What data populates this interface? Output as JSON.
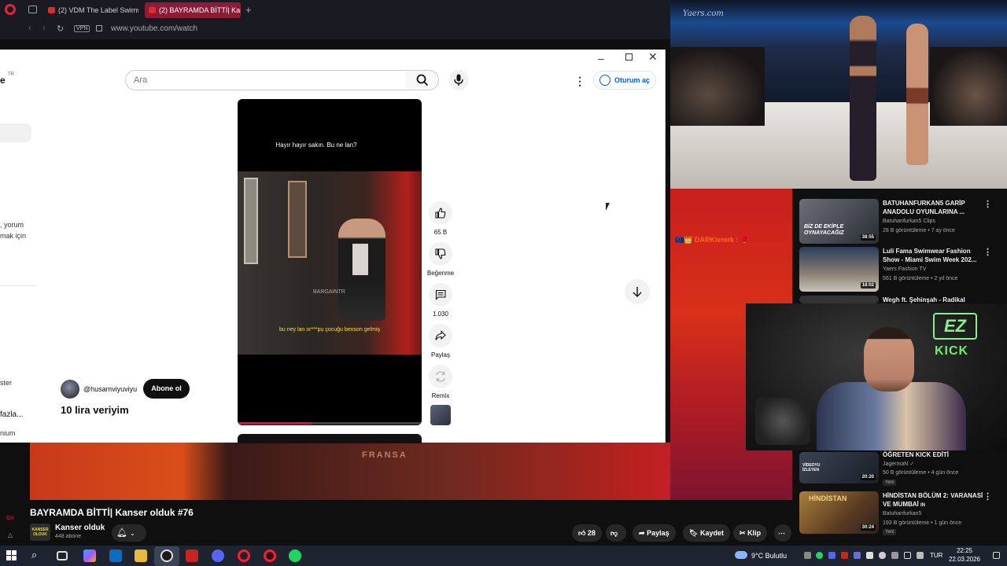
{
  "browser": {
    "tabs": [
      {
        "label": "(2) VDM The Label Swimw"
      },
      {
        "label": "(2) BAYRAMDA BİTTİ| Kan"
      }
    ],
    "new_tab": "+",
    "vpn": "VPN",
    "url": "www.youtube.com/watch"
  },
  "popup": {
    "logo_fragment": "e",
    "logo_country": "TR",
    "search_placeholder": "Ara",
    "signin_label": "Oturum aç",
    "sidebar_texts": [
      ", yorum",
      "mak için",
      "ster",
      "fazla...",
      "nium"
    ]
  },
  "short": {
    "caption": "Hayır hayır sakın. Bu ne lan?",
    "watermark": "BARGAINTR",
    "subtitle": "bu ney lan or***pu çocuğu benson gelmiş",
    "progress_pct": 40,
    "channel_handle": "@husamviyuviyu",
    "subscribe_label": "Abone ol",
    "title": "10 lira veriyim",
    "actions": {
      "likes": "65 B",
      "dislike": "Beğenme",
      "comments": "1.030",
      "share": "Paylaş",
      "remix": "Remix"
    }
  },
  "background_page": {
    "video_overlay_text": "FRANSA",
    "title": "BAYRAMDA BİTTİ| Kanser olduk #76",
    "channel_avatar_text": "KANSER OLDUK",
    "channel_name": "Kanser olduk",
    "subscribers": "448 abone",
    "like_count": "28",
    "share_label": "Paylaş",
    "save_label": "Kaydet",
    "clip_label": "Klip",
    "left_edge": [
      "GX",
      "△"
    ]
  },
  "runway": {
    "logo": "Yaers.com"
  },
  "chat": {
    "line": "🇪🇺👑 DARKlenirk : 🥊"
  },
  "recommendations": [
    {
      "title": "BATUHANFURKAN5 GARİP ANADOLU OYUNLARINA ...",
      "channel": "Batuhanfurkan5 Clips",
      "meta": "28 B görüntüleme • 7 ay önce",
      "duration": "38:55",
      "thumb_text": "BİZ DE EKİPLE OYNAYACAĞIZ"
    },
    {
      "title": "Luli Fama Swimwear Fashion Show - Miami Swim Week 202...",
      "channel": "Yaers Fashion TV",
      "meta": "561 B görüntüleme • 2 yıl önce",
      "duration": "18:02",
      "thumb_text": ""
    },
    {
      "title": "Wegh ft. Şehinşah - Radikal",
      "channel": "",
      "meta": "",
      "duration": "",
      "thumb_text": ""
    },
    {
      "title": "ÖĞRETEN KICK EDİTİ",
      "channel": "JagermaN",
      "meta": "50 B görüntüleme • 4 gün önce",
      "badge": "Yeni",
      "duration": "20:20",
      "thumb_text": "VİDEOYU İZLEYEN"
    },
    {
      "title": "HİNDİSTAN BÖLÜM 2: VARANASİ VE MUMBAİ",
      "title_suffix": "IN",
      "channel": "Batuhanfurkan5",
      "meta": "193 B görüntüleme • 1 gün önce",
      "badge": "Yeni",
      "duration": "30:24",
      "thumb_text": "HİNDİSTAN"
    }
  ],
  "webcam": {
    "ez": "EZ",
    "kick": "KICK"
  },
  "taskbar": {
    "weather": "9°C  Bulutlu",
    "lang": "TUR",
    "time": "22:25",
    "date": "22.03.2026"
  }
}
